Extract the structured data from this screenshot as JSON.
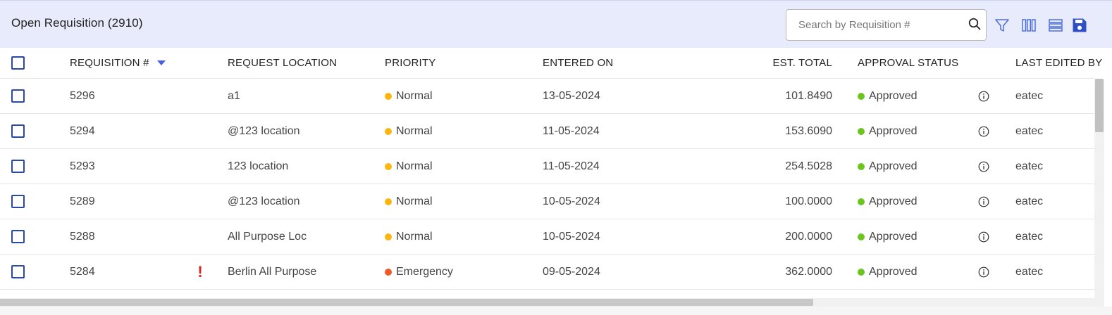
{
  "header": {
    "title": "Open Requisition (2910)",
    "search_placeholder": "Search by Requisition #",
    "search_value": "",
    "icons": [
      "search-icon",
      "filter-icon",
      "columns-icon",
      "density-icon",
      "save-icon"
    ]
  },
  "table": {
    "columns": {
      "requisition": "REQUISITION #",
      "request_location": "REQUEST LOCATION",
      "priority": "PRIORITY",
      "entered_on": "ENTERED ON",
      "est_total": "EST. TOTAL",
      "approval_status": "APPROVAL STATUS",
      "last_edited_by": "LAST EDITED BY"
    },
    "sort": {
      "column": "requisition",
      "direction": "desc"
    },
    "rows": [
      {
        "requisition": "5296",
        "alert": "",
        "location": "a1",
        "priority": "Normal",
        "priority_color": "#fbb710",
        "entered_on": "13-05-2024",
        "est_total": "101.8490",
        "status": "Approved",
        "status_color": "#6cc41f",
        "last_edited_by": "eatec"
      },
      {
        "requisition": "5294",
        "alert": "",
        "location": "@123 location",
        "priority": "Normal",
        "priority_color": "#fbb710",
        "entered_on": "11-05-2024",
        "est_total": "153.6090",
        "status": "Approved",
        "status_color": "#6cc41f",
        "last_edited_by": "eatec"
      },
      {
        "requisition": "5293",
        "alert": "",
        "location": "123 location",
        "priority": "Normal",
        "priority_color": "#fbb710",
        "entered_on": "11-05-2024",
        "est_total": "254.5028",
        "status": "Approved",
        "status_color": "#6cc41f",
        "last_edited_by": "eatec"
      },
      {
        "requisition": "5289",
        "alert": "",
        "location": "@123 location",
        "priority": "Normal",
        "priority_color": "#fbb710",
        "entered_on": "10-05-2024",
        "est_total": "100.0000",
        "status": "Approved",
        "status_color": "#6cc41f",
        "last_edited_by": "eatec"
      },
      {
        "requisition": "5288",
        "alert": "",
        "location": "All Purpose Loc",
        "priority": "Normal",
        "priority_color": "#fbb710",
        "entered_on": "10-05-2024",
        "est_total": "200.0000",
        "status": "Approved",
        "status_color": "#6cc41f",
        "last_edited_by": "eatec"
      },
      {
        "requisition": "5284",
        "alert": "!",
        "location": "Berlin All Purpose",
        "priority": "Emergency",
        "priority_color": "#f05a28",
        "entered_on": "09-05-2024",
        "est_total": "362.0000",
        "status": "Approved",
        "status_color": "#6cc41f",
        "last_edited_by": "eatec"
      }
    ]
  },
  "colors": {
    "header_bg": "#e8ebfc",
    "accent": "#3b5bdb",
    "checkbox_border": "#2a48a8",
    "alert": "#e0201b"
  }
}
